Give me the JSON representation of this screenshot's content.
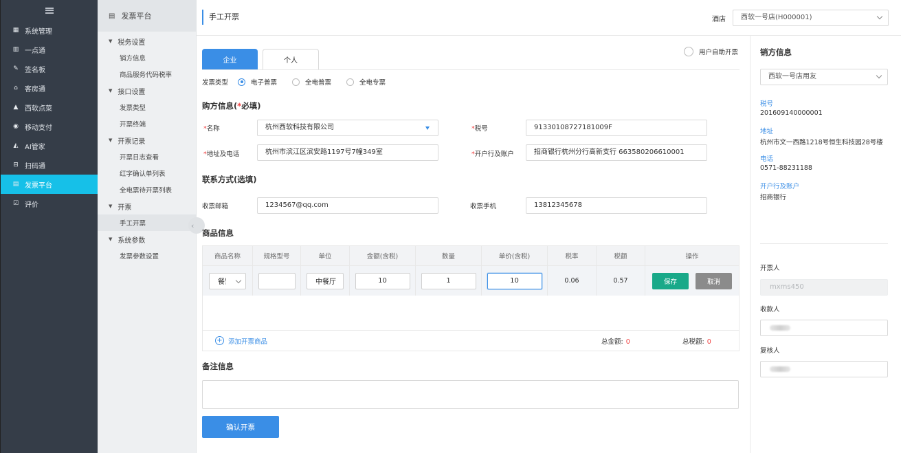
{
  "nav": {
    "items": [
      {
        "icon": "grid-icon",
        "glyph": "▦",
        "label": "系统管理"
      },
      {
        "icon": "bar-chart-icon",
        "glyph": "▥",
        "label": "一点通"
      },
      {
        "icon": "signature-icon",
        "glyph": "✎",
        "label": "签名板"
      },
      {
        "icon": "home-icon",
        "glyph": "⌂",
        "label": "客房通"
      },
      {
        "icon": "food-icon",
        "glyph": "▲",
        "label": "西软点菜"
      },
      {
        "icon": "pay-icon",
        "glyph": "◉",
        "label": "移动支付"
      },
      {
        "icon": "butler-icon",
        "glyph": "◭",
        "label": "AI管家"
      },
      {
        "icon": "scan-icon",
        "glyph": "⊟",
        "label": "扫码通"
      },
      {
        "icon": "invoice-icon",
        "glyph": "▤",
        "label": "发票平台"
      },
      {
        "icon": "review-icon",
        "glyph": "☑",
        "label": "评价"
      }
    ],
    "active_index": 8
  },
  "submenu": {
    "title": "发票平台",
    "groups": [
      {
        "label": "税务设置",
        "links": [
          "销方信息",
          "商品服务代码税率"
        ]
      },
      {
        "label": "接口设置",
        "links": [
          "发票类型",
          "开票终端"
        ]
      },
      {
        "label": "开票记录",
        "links": [
          "开票日志查看",
          "红字确认单列表",
          "全电票待开票列表"
        ]
      },
      {
        "label": "开票",
        "links": [
          "手工开票"
        ]
      },
      {
        "label": "系统参数",
        "links": [
          "发票参数设置"
        ]
      }
    ]
  },
  "header": {
    "title": "手工开票",
    "hotel_label": "酒店",
    "hotel_value": "西软一号店(H000001)"
  },
  "tabs": {
    "enterprise": "企业",
    "personal": "个人"
  },
  "self_issue": "用户自助开票",
  "invoice_type": {
    "label": "发票类型",
    "options": [
      "电子普票",
      "全电普票",
      "全电专票"
    ],
    "selected": "电子普票"
  },
  "buyer": {
    "title": "购方信息(",
    "title_star": "*",
    "title_suffix": "必填)",
    "name_label": "名称",
    "name_value": "杭州西软科技有限公司",
    "tax_label": "税号",
    "tax_value": "91330108727181009F",
    "addr_label": "地址及电话",
    "addr_value": "杭州市滨江区滨安路1197号7幢349室",
    "bank_label": "开户行及账户",
    "bank_value": "招商银行杭州分行高新支行 663580206610001"
  },
  "contact": {
    "title": "联系方式(选填)",
    "email_label": "收票邮箱",
    "email_value": "1234567@qq.com",
    "phone_label": "收票手机",
    "phone_value": "13812345678"
  },
  "goods": {
    "title": "商品信息",
    "columns": [
      "商品名称",
      "规格型号",
      "单位",
      "金额(含税)",
      "数量",
      "单价(含税)",
      "税率",
      "税额",
      "操作"
    ],
    "row": {
      "name": "餐饮",
      "spec": "",
      "unit": "中餐厅",
      "amount": "10",
      "qty": "1",
      "price": "10",
      "rate": "0.06",
      "tax": "0.57"
    },
    "save": "保存",
    "cancel": "取消",
    "add": "添加开票商品",
    "total_amount_label": "总金额:",
    "total_amount": "0",
    "total_tax_label": "总税额:",
    "total_tax": "0"
  },
  "remark_title": "备注信息",
  "confirm": "确认开票",
  "seller": {
    "title": "销方信息",
    "select_value": "西软一号店用友",
    "tax_key": "税号",
    "tax_value": "201609140000001",
    "addr_key": "地址",
    "addr_value": "杭州市文一西路1218号恒生科技园28号楼",
    "phone_key": "电话",
    "phone_value": "0571-88231188",
    "bank_key": "开户行及账户",
    "bank_value": "招商银行",
    "issuer_label": "开票人",
    "issuer_value": "mxms450",
    "payee_label": "收款人",
    "reviewer_label": "复核人"
  }
}
